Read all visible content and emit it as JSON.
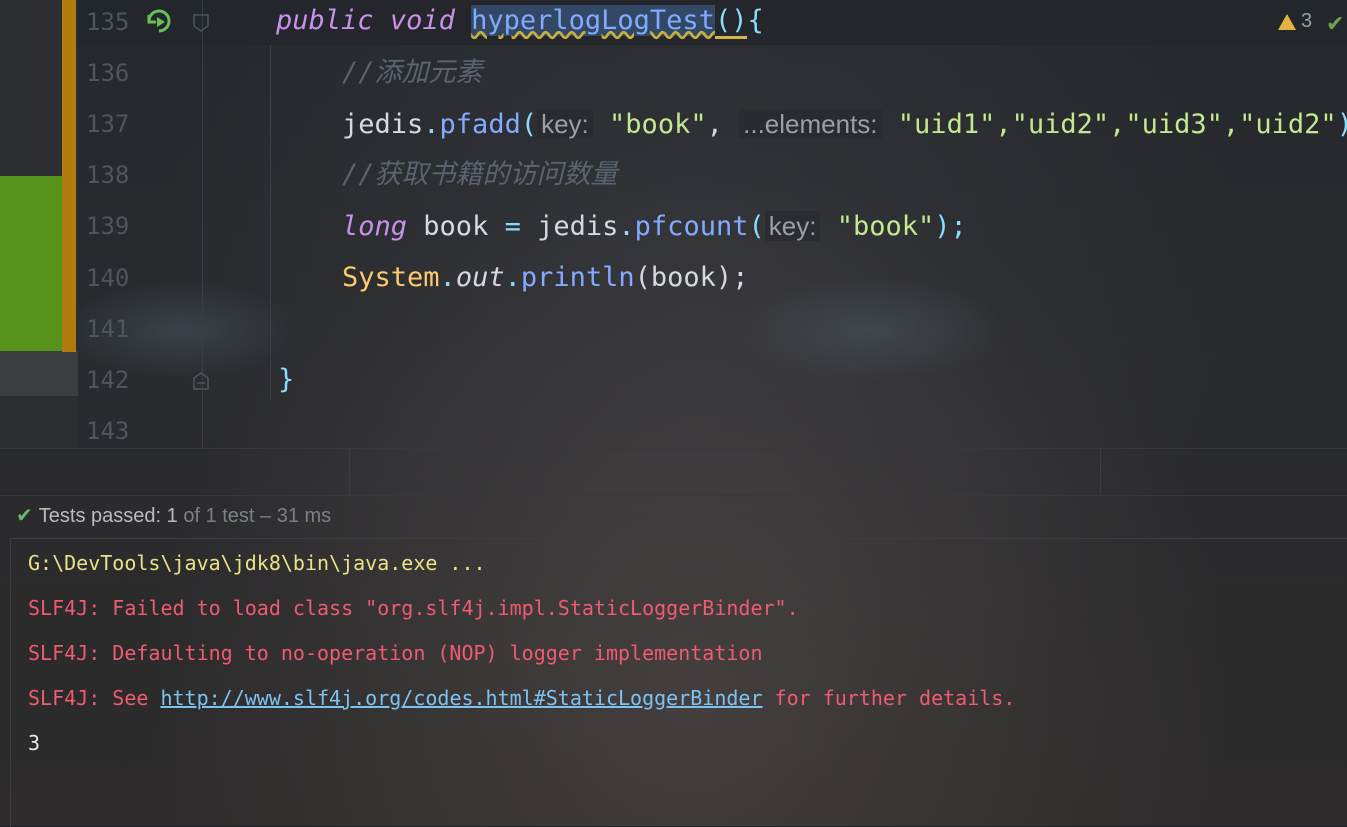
{
  "editor": {
    "line_numbers": [
      "135",
      "136",
      "137",
      "138",
      "139",
      "140",
      "141",
      "142",
      "143"
    ],
    "line135": {
      "kw_public": "public",
      "kw_void": "void",
      "method": "hyperlogLogTest",
      "parens": "()",
      "brace": "{"
    },
    "line136": {
      "comment": "//添加元素"
    },
    "line137": {
      "obj": "jedis",
      "dot": ".",
      "method": "pfadd",
      "open": "(",
      "hint_key": "key:",
      "str_book": "\"book\"",
      "comma": ",",
      "hint_elements": "...elements:",
      "args": "\"uid1\",\"uid2\",\"uid3\",\"uid2\"",
      "close": ");"
    },
    "line138": {
      "comment": "//获取书籍的访问数量"
    },
    "line139": {
      "kw_long": "long",
      "var": "book",
      "eq": "=",
      "obj": "jedis",
      "dot": ".",
      "method": "pfcount",
      "open": "(",
      "hint_key": "key:",
      "str_book": "\"book\"",
      "close": ");"
    },
    "line140": {
      "cls": "System",
      "dot1": ".",
      "field": "out",
      "dot2": ".",
      "method": "println",
      "args": "(book);"
    },
    "line142": {
      "brace": "}"
    },
    "warnings_count": "3"
  },
  "status": {
    "label": "Tests passed:",
    "count": "1",
    "rest": "of 1 test – 31 ms"
  },
  "console": {
    "line1": "G:\\DevTools\\java\\jdk8\\bin\\java.exe ...",
    "line2": "SLF4J: Failed to load class \"org.slf4j.impl.StaticLoggerBinder\".",
    "line3": "SLF4J: Defaulting to no-operation (NOP) logger implementation",
    "line4_prefix": "SLF4J: See ",
    "line4_link": "http://www.slf4j.org/codes.html#StaticLoggerBinder",
    "line4_suffix": " for further details.",
    "line5": "3"
  },
  "colors": {
    "keyword": "#c792ea",
    "method": "#82aaff",
    "string": "#c3e88d",
    "class": "#ffcb6b",
    "error": "#ef5b6f",
    "path": "#ece184",
    "pass_check": "#67b86b"
  }
}
